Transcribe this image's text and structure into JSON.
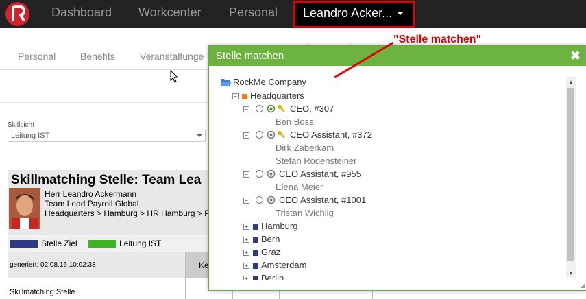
{
  "topnav": {
    "items": [
      "Dashboard",
      "Workcenter",
      "Personal"
    ],
    "user": "Leandro Acker..."
  },
  "annotation": "\"Stelle matchen\"",
  "tabs": [
    "Personal",
    "Benefits",
    "Veranstaltunge"
  ],
  "skillsicht": {
    "label": "Skillsicht",
    "value": "Leitung IST"
  },
  "report": {
    "title": "Skillmatching Stelle: Team Lea",
    "person": [
      "Herr Leandro Ackermann",
      "Team Lead Payroll Global",
      "Headquarters > Hamburg > HR Hamburg > P"
    ],
    "legend": [
      {
        "label": "Stelle Ziel",
        "color": "#2e3a87"
      },
      {
        "label": "Leitung IST",
        "color": "#3cb521"
      }
    ],
    "generated": "generiert: 02.08.16 10:02:38",
    "col_first": "Ke",
    "row_label": "Skillmatching Stelle"
  },
  "modal": {
    "title": "Stelle matchen",
    "close": "✖",
    "root": "RockMe Company",
    "hq": "Headquarters",
    "positions": [
      {
        "label": "CEO, #307",
        "holders": [
          "Ben Boss"
        ],
        "key": true
      },
      {
        "label": "CEO Assistant, #372",
        "holders": [
          "Dirk Zaberkam",
          "Stefan Rodensteiner"
        ],
        "key": true
      },
      {
        "label": "CEO Assistant, #955",
        "holders": [
          "Elena Meier"
        ],
        "key": false
      },
      {
        "label": "CEO Assistant, #1001",
        "holders": [
          "Tristan Wichlig"
        ],
        "key": false
      }
    ],
    "locations": [
      "Hamburg",
      "Bern",
      "Graz",
      "Amsterdam",
      "Berlin"
    ],
    "colors": {
      "header": "#6cb33f",
      "hq": "#f07820",
      "location": "#2e3a87"
    }
  }
}
